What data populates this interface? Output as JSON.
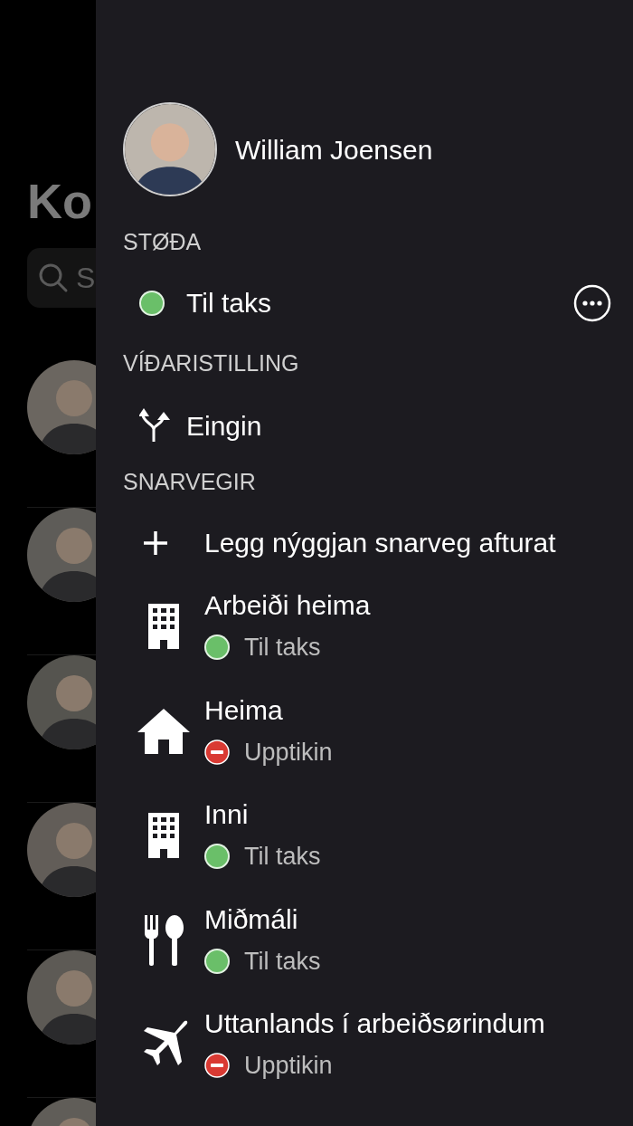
{
  "background": {
    "title": "Ko",
    "search": {
      "placeholder": "S"
    }
  },
  "drawer": {
    "user": {
      "name": "William Joensen"
    },
    "status_section": {
      "heading": "STØÐA",
      "status": {
        "label": "Til taks",
        "kind": "available"
      }
    },
    "forwarding_section": {
      "heading": "VÍÐARISTILLING",
      "value": "Eingin"
    },
    "shortcuts_section": {
      "heading": "SNARVEGIR",
      "add_label": "Legg nýggjan snarveg afturat",
      "items": [
        {
          "title": "Arbeiði heima",
          "kind": "building",
          "status": {
            "label": "Til taks",
            "kind": "available"
          }
        },
        {
          "title": "Heima",
          "kind": "home",
          "status": {
            "label": "Upptikin",
            "kind": "busy"
          }
        },
        {
          "title": "Inni",
          "kind": "building",
          "status": {
            "label": "Til taks",
            "kind": "available"
          }
        },
        {
          "title": "Miðmáli",
          "kind": "food",
          "status": {
            "label": "Til taks",
            "kind": "available"
          }
        },
        {
          "title": "Uttanlands í arbeiðsørindum",
          "kind": "plane",
          "status": {
            "label": "Upptikin",
            "kind": "busy"
          }
        }
      ]
    }
  }
}
